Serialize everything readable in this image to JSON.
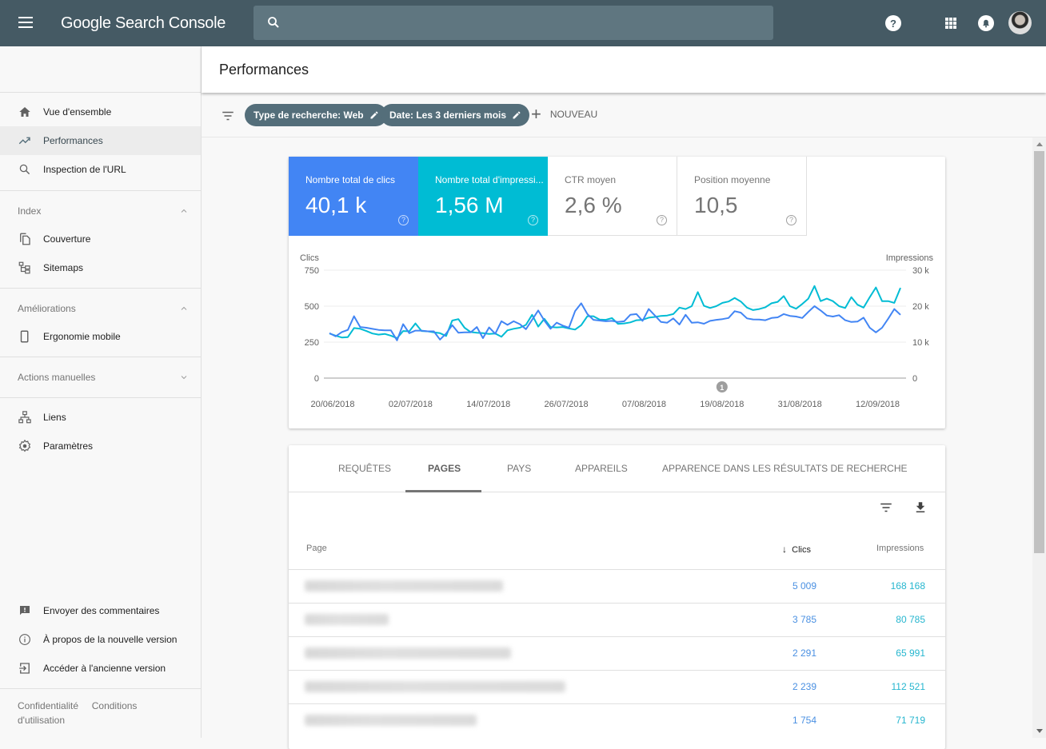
{
  "app": {
    "title": "Google Search Console",
    "search_placeholder": ""
  },
  "topbar": {
    "icons": [
      "menu-icon",
      "search-icon",
      "help-icon",
      "apps-icon",
      "notifications-icon",
      "avatar"
    ]
  },
  "sidebar": {
    "items_top": [
      {
        "label": "Vue d'ensemble",
        "icon": "home-icon",
        "active": false
      },
      {
        "label": "Performances",
        "icon": "trending-up-icon",
        "active": true
      },
      {
        "label": "Inspection de l'URL",
        "icon": "search-icon",
        "active": false
      }
    ],
    "sections": [
      {
        "title": "Index",
        "expanded": true,
        "items": [
          {
            "label": "Couverture",
            "icon": "copy-icon"
          },
          {
            "label": "Sitemaps",
            "icon": "sitemap-icon"
          }
        ]
      },
      {
        "title": "Améliorations",
        "expanded": true,
        "items": [
          {
            "label": "Ergonomie mobile",
            "icon": "smartphone-icon"
          }
        ]
      },
      {
        "title": "Actions manuelles",
        "expanded": false,
        "items": []
      }
    ],
    "items_misc": [
      {
        "label": "Liens",
        "icon": "links-icon"
      },
      {
        "label": "Paramètres",
        "icon": "settings-icon"
      }
    ],
    "items_bottom": [
      {
        "label": "Envoyer des commentaires",
        "icon": "feedback-icon"
      },
      {
        "label": "À propos de la nouvelle version",
        "icon": "info-icon"
      },
      {
        "label": "Accéder à l'ancienne version",
        "icon": "exit-to-app-icon"
      }
    ],
    "footer": {
      "privacy": "Confidentialité",
      "terms": "Conditions d'utilisation"
    }
  },
  "page": {
    "title": "Performances"
  },
  "filters": {
    "chips": [
      "Type de recherche: Web",
      "Date: Les 3 derniers mois"
    ],
    "new_label": "NOUVEAU"
  },
  "metrics": [
    {
      "title": "Nombre total de clics",
      "value": "40,1 k",
      "selected": true,
      "color": "#4285f4"
    },
    {
      "title": "Nombre total d'impressi...",
      "value": "1,56 M",
      "selected": true,
      "color": "#00bcd4"
    },
    {
      "title": "CTR moyen",
      "value": "2,6 %",
      "selected": false
    },
    {
      "title": "Position moyenne",
      "value": "10,5",
      "selected": false
    }
  ],
  "chart_data": {
    "type": "line",
    "title": "",
    "ylabel": "Clics",
    "ylabel_right": "Impressions",
    "ylim": [
      0,
      750
    ],
    "ylim_right": [
      0,
      30000
    ],
    "yticks": [
      "0",
      "250",
      "500",
      "750"
    ],
    "yticks_right": [
      "0",
      "10 k",
      "20 k",
      "30 k"
    ],
    "xticks": [
      "20/06/2018",
      "02/07/2018",
      "14/07/2018",
      "26/07/2018",
      "07/08/2018",
      "19/08/2018",
      "31/08/2018",
      "12/09/2018"
    ],
    "x_start": "20/06/2018",
    "x_days": 88,
    "annotation": {
      "label": "1",
      "date": "19/08/2018"
    },
    "grid": true,
    "series": [
      {
        "name": "Clics",
        "color": "#4285f4",
        "axis": "left",
        "values": [
          312,
          290,
          320,
          335,
          430,
          355,
          350,
          342,
          335,
          332,
          332,
          262,
          375,
          312,
          330,
          330,
          325,
          325,
          268,
          310,
          368,
          315,
          318,
          318,
          355,
          278,
          352,
          308,
          395,
          370,
          395,
          375,
          340,
          405,
          470,
          400,
          343,
          385,
          365,
          350,
          465,
          520,
          445,
          405,
          400,
          395,
          398,
          390,
          395,
          440,
          445,
          398,
          480,
          435,
          390,
          385,
          415,
          372,
          440,
          385,
          388,
          378,
          398,
          405,
          410,
          418,
          465,
          455,
          415,
          408,
          407,
          402,
          418,
          422,
          445,
          432,
          428,
          418,
          460,
          500,
          470,
          435,
          428,
          437,
          402,
          390,
          393,
          420,
          350,
          318,
          350,
          412,
          480,
          440
        ]
      },
      {
        "name": "Impressions",
        "color": "#00bcd4",
        "axis": "right",
        "values": [
          12400,
          11800,
          11300,
          11400,
          13900,
          13700,
          13100,
          12400,
          12100,
          12300,
          11800,
          11100,
          13100,
          13000,
          15200,
          13100,
          13000,
          12700,
          12500,
          11700,
          16000,
          16400,
          14000,
          12800,
          12600,
          12500,
          12300,
          12400,
          11500,
          13300,
          13700,
          14000,
          14800,
          17600,
          14300,
          16500,
          14200,
          14100,
          14200,
          13800,
          13500,
          14700,
          17200,
          17200,
          16300,
          16200,
          16700,
          15100,
          15200,
          15500,
          16100,
          16200,
          16800,
          17000,
          17300,
          17400,
          17800,
          19600,
          19200,
          20000,
          23900,
          20100,
          19500,
          20000,
          20900,
          21300,
          22300,
          21300,
          19600,
          18900,
          19200,
          19700,
          20800,
          21200,
          22800,
          20000,
          19300,
          20600,
          22100,
          25600,
          21400,
          22100,
          21400,
          20000,
          19500,
          22500,
          20400,
          19600,
          22500,
          25200,
          21400,
          21400,
          20900,
          25100
        ]
      }
    ]
  },
  "tabs": {
    "items": [
      "REQUÊTES",
      "PAGES",
      "PAYS",
      "APPAREILS",
      "APPARENCE DANS LES RÉSULTATS DE RECHERCHE"
    ],
    "active": "PAGES"
  },
  "table": {
    "headers": {
      "page": "Page",
      "clics": "Clics",
      "impressions": "Impressions"
    },
    "sort_column": "clics",
    "sort_direction": "desc",
    "rows": [
      {
        "page": "(URL masquée)",
        "clics": "5 009",
        "impressions": "168 168"
      },
      {
        "page": "(URL masquée)",
        "clics": "3 785",
        "impressions": "80 785"
      },
      {
        "page": "(URL masquée)",
        "clics": "2 291",
        "impressions": "65 991"
      },
      {
        "page": "(URL masquée)",
        "clics": "2 239",
        "impressions": "112 521"
      },
      {
        "page": "(URL masquée)",
        "clics": "1 754",
        "impressions": "71 719"
      }
    ]
  }
}
